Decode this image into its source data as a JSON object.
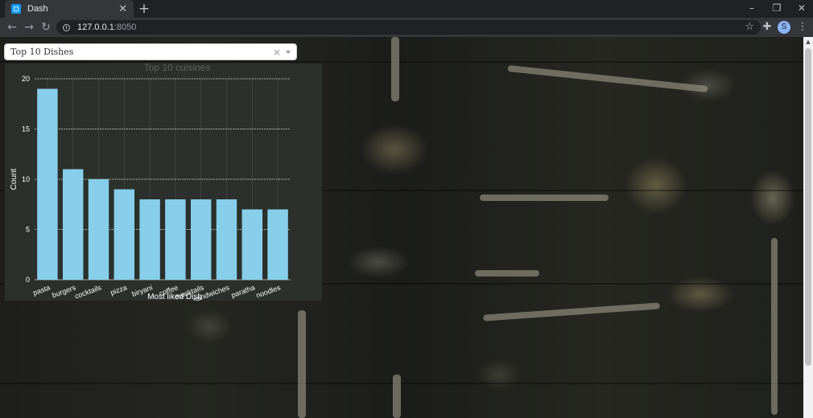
{
  "browser": {
    "tab_title": "Dash",
    "url_host": "127.0.0.1",
    "url_port": ":8050",
    "profile_initial": "S"
  },
  "dropdown": {
    "selected": "Top 10 Dishes"
  },
  "colors": {
    "bar": "#87ceeb",
    "panel_bg": "#2b302c",
    "text": "#ffffff"
  },
  "chart_data": {
    "type": "bar",
    "title": "Top 10 cuisines",
    "xlabel": "Most liked Dish",
    "ylabel": "Count",
    "categories": [
      "pasta",
      "burgers",
      "cocktails",
      "pizza",
      "biryani",
      "coffee",
      "mocktails",
      "sandwiches",
      "paratha",
      "noodles"
    ],
    "values": [
      19,
      11,
      10,
      9,
      8,
      8,
      8,
      8,
      7,
      7
    ],
    "ylim": [
      0,
      20
    ],
    "yticks": [
      0,
      5,
      10,
      15,
      20
    ],
    "grid": true
  }
}
